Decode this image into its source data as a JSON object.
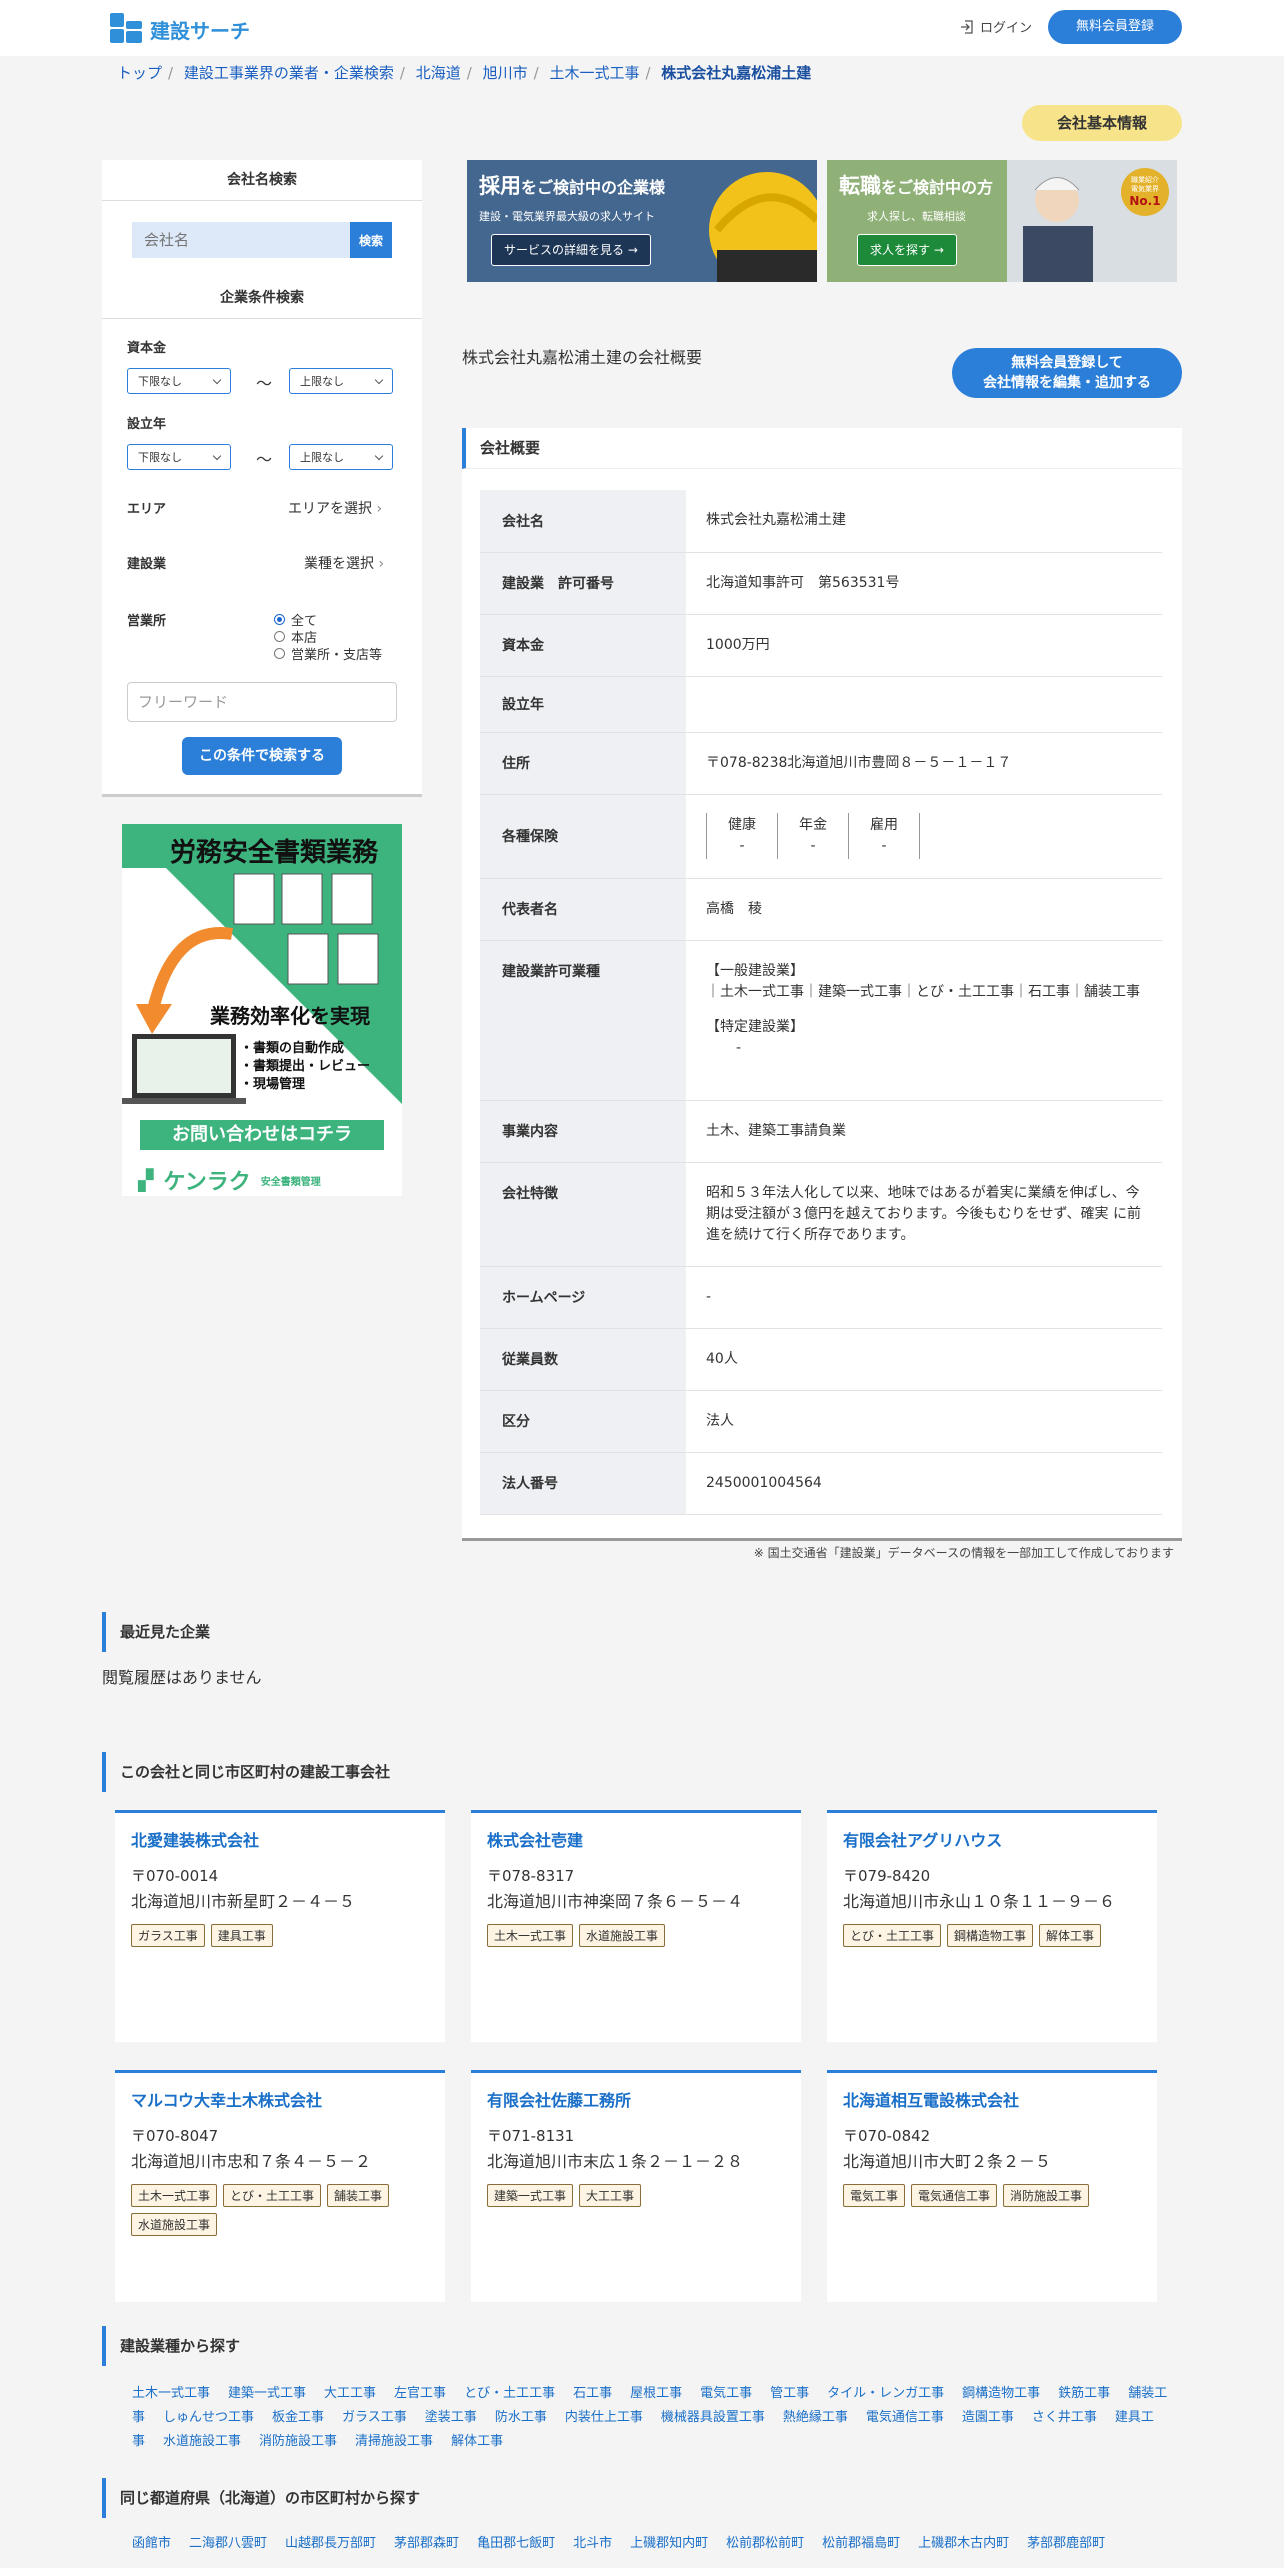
{
  "header": {
    "logo_text": "建設サーチ",
    "login_label": "ログイン",
    "register_label": "無料会員登録"
  },
  "breadcrumb": [
    "トップ",
    "建設工事業界の業者・企業検索",
    "北海道",
    "旭川市",
    "土木一式工事",
    "株式会社丸嘉松浦土建"
  ],
  "basic_badge": "会社基本情報",
  "sidebar": {
    "company_search_title": "会社名検索",
    "company_placeholder": "会社名",
    "search_btn": "検索",
    "cond_title": "企業条件検索",
    "capital_label": "資本金",
    "year_label": "設立年",
    "lower": "下限なし",
    "upper": "上限なし",
    "tilde": "〜",
    "area_label": "エリア",
    "area_pick": "エリアを選択",
    "industry_label": "建設業",
    "industry_pick": "業種を選択",
    "office_label": "営業所",
    "radio_all": "全て",
    "radio_head": "本店",
    "radio_branch": "営業所・支店等",
    "freeword_placeholder": "フリーワード",
    "cond_btn": "この条件で検索する"
  },
  "ad": {
    "title": "労務安全書類業務",
    "headline": "業務効率化を実現",
    "bullets": [
      "・書類の自動作成",
      "・書類提出・レビュー",
      "・現場管理"
    ],
    "cta": "お問い合わせはコチラ",
    "brand": "ケンラク",
    "brand_sub": "安全書類管理"
  },
  "banner1": {
    "title_big": "採用",
    "title_small": "をご検討中の企業様",
    "sub": "建設・電気業界最大級の求人サイト",
    "btn": "サービスの詳細を見る →"
  },
  "banner2": {
    "title_big": "転職",
    "title_small": "をご検討中の方",
    "sub": "求人探し、転職相談",
    "btn": "求人を探す →",
    "badge_top": "職業紹介",
    "badge_mid": "電気業界",
    "badge_rank": "No.1"
  },
  "overview": {
    "page_title": "株式会社丸嘉松浦土建の会社概要",
    "edit_btn_line1": "無料会員登録して",
    "edit_btn_line2": "会社情報を編集・追加する",
    "panel_title": "会社概要",
    "rows": {
      "name_k": "会社名",
      "name_v": "株式会社丸嘉松浦土建",
      "permit_k": "建設業　許可番号",
      "permit_v": "北海道知事許可　第563531号",
      "capital_k": "資本金",
      "capital_v": "1000万円",
      "year_k": "設立年",
      "year_v": "",
      "address_k": "住所",
      "address_v": "〒078-8238北海道旭川市豊岡８－５－１－１７",
      "insurance_k": "各種保険",
      "ins_health": "健康",
      "ins_pension": "年金",
      "ins_employ": "雇用",
      "ins_dash": "-",
      "rep_k": "代表者名",
      "rep_v": "高橋　稜",
      "ptype_k": "建設業許可業種",
      "ptype_general": "【一般建設業】",
      "ptype_general_v": "｜土木一式工事｜建築一式工事｜とび・土工工事｜石工事｜舗装工事",
      "ptype_special": "【特定建設業】",
      "ptype_special_v": "-",
      "biz_k": "事業内容",
      "biz_v": "土木、建築工事請負業",
      "feature_k": "会社特徴",
      "feature_v": "昭和５３年法人化して以来、地味ではあるが着実に業績を伸ばし、今期は受注額が３億円を越えております。今後もむりをせず、確実 に前進を続けて行く所存であります。",
      "hp_k": "ホームページ",
      "hp_v": "-",
      "emp_k": "従業員数",
      "emp_v": "40人",
      "class_k": "区分",
      "class_v": "法人",
      "corpno_k": "法人番号",
      "corpno_v": "2450001004564"
    },
    "note": "※ 国土交通省「建設業」データベースの情報を一部加工して作成しております"
  },
  "recent": {
    "title": "最近見た企業",
    "empty": "閲覧履歴はありません"
  },
  "same_city": {
    "title": "この会社と同じ市区町村の建設工事会社",
    "cards": [
      {
        "name": "北愛建装株式会社",
        "zip": "〒070-0014",
        "addr": "北海道旭川市新星町２－４－５",
        "tags": [
          "ガラス工事",
          "建具工事"
        ]
      },
      {
        "name": "株式会社壱建",
        "zip": "〒078-8317",
        "addr": "北海道旭川市神楽岡７条６－５－４",
        "tags": [
          "土木一式工事",
          "水道施設工事"
        ]
      },
      {
        "name": "有限会社アグリハウス",
        "zip": "〒079-8420",
        "addr": "北海道旭川市永山１０条１１－９－６",
        "tags": [
          "とび・土工工事",
          "鋼構造物工事",
          "解体工事"
        ]
      },
      {
        "name": "マルコウ大幸土木株式会社",
        "zip": "〒070-8047",
        "addr": "北海道旭川市忠和７条４－５－２",
        "tags": [
          "土木一式工事",
          "とび・土工工事",
          "舗装工事",
          "水道施設工事"
        ]
      },
      {
        "name": "有限会社佐藤工務所",
        "zip": "〒071-8131",
        "addr": "北海道旭川市末広１条２－１－２８",
        "tags": [
          "建築一式工事",
          "大工工事"
        ]
      },
      {
        "name": "北海道相互電設株式会社",
        "zip": "〒070-0842",
        "addr": "北海道旭川市大町２条２－５",
        "tags": [
          "電気工事",
          "電気通信工事",
          "消防施設工事"
        ]
      }
    ]
  },
  "industries": {
    "title": "建設業種から探す",
    "items": [
      "土木一式工事",
      "建築一式工事",
      "大工工事",
      "左官工事",
      "とび・土工工事",
      "石工事",
      "屋根工事",
      "電気工事",
      "管工事",
      "タイル・レンガ工事",
      "鋼構造物工事",
      "鉄筋工事",
      "舗装工事",
      "しゅんせつ工事",
      "板金工事",
      "ガラス工事",
      "塗装工事",
      "防水工事",
      "内装仕上工事",
      "機械器具設置工事",
      "熱絶縁工事",
      "電気通信工事",
      "造園工事",
      "さく井工事",
      "建具工事",
      "水道施設工事",
      "消防施設工事",
      "清掃施設工事",
      "解体工事"
    ]
  },
  "prefecture": {
    "title": "同じ都道府県（北海道）の市区町村から探す",
    "items": [
      "函館市",
      "二海郡八雲町",
      "山越郡長万部町",
      "茅部郡森町",
      "亀田郡七飯町",
      "北斗市",
      "上磯郡知内町",
      "松前郡松前町",
      "松前郡福島町",
      "上磯郡木古内町",
      "茅部郡鹿部町"
    ]
  }
}
